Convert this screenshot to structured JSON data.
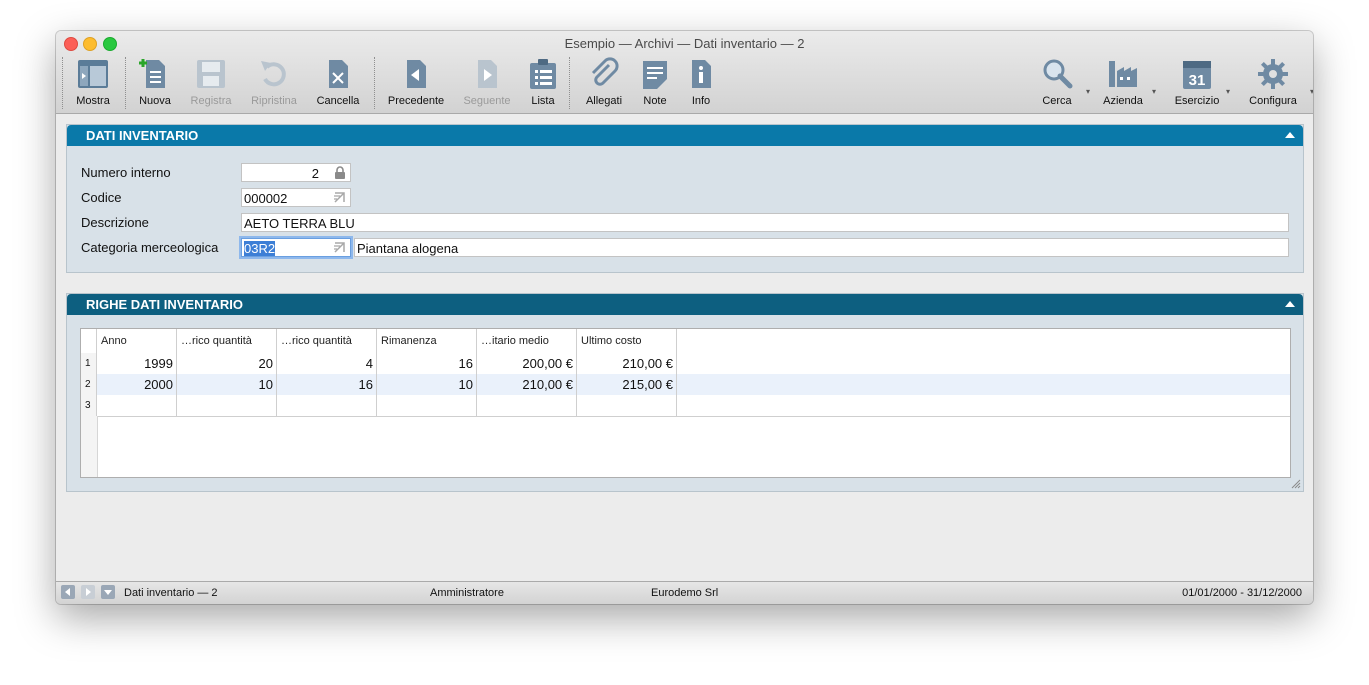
{
  "window": {
    "title": "Esempio — Archivi — Dati inventario — 2"
  },
  "toolbar": {
    "mostra": "Mostra",
    "nuova": "Nuova",
    "registra": "Registra",
    "ripristina": "Ripristina",
    "cancella": "Cancella",
    "precedente": "Precedente",
    "seguente": "Seguente",
    "lista": "Lista",
    "allegati": "Allegati",
    "note": "Note",
    "info": "Info",
    "cerca": "Cerca",
    "azienda": "Azienda",
    "esercizio": "Esercizio",
    "configura": "Configura",
    "calendar_day": "31",
    "menu_arrow": "▾"
  },
  "dati": {
    "header": "DATI INVENTARIO",
    "numero_label": "Numero interno",
    "numero_value": "2",
    "codice_label": "Codice",
    "codice_value": "000002",
    "descrizione_label": "Descrizione",
    "descrizione_value": "AETO TERRA BLU",
    "categoria_label": "Categoria merceologica",
    "categoria_code": "03R2",
    "categoria_desc": "Piantana alogena"
  },
  "righe": {
    "header": "RIGHE DATI INVENTARIO",
    "columns": [
      "Anno",
      "…rico quantità",
      "…rico quantità",
      "Rimanenza",
      "…itario medio",
      "Ultimo costo"
    ],
    "rows": [
      {
        "n": "1",
        "cells": [
          "1999",
          "20",
          "4",
          "16",
          "200,00 €",
          "210,00 €"
        ]
      },
      {
        "n": "2",
        "cells": [
          "2000",
          "10",
          "16",
          "10",
          "210,00 €",
          "215,00 €"
        ]
      },
      {
        "n": "3",
        "cells": [
          "",
          "",
          "",
          "",
          "",
          ""
        ]
      }
    ]
  },
  "status": {
    "record": "Dati inventario — 2",
    "user": "Amministratore",
    "company": "Eurodemo Srl",
    "period": "01/01/2000 - 31/12/2000"
  },
  "colors": {
    "panel_header": "#0a79a9",
    "panel_header_dark": "#0d5f80",
    "selection": "#3d7fd6"
  }
}
